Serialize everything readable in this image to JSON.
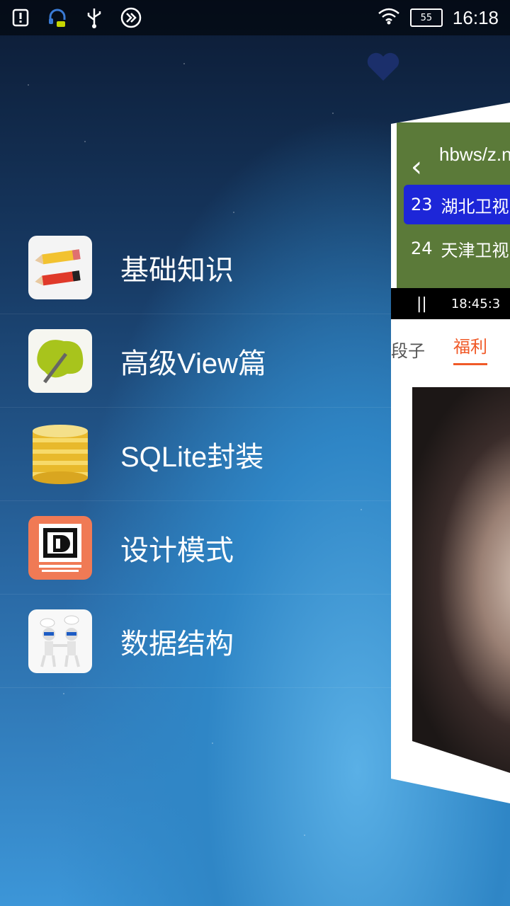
{
  "status_bar": {
    "icons": [
      "alert-icon",
      "headset-icon",
      "usb-icon",
      "fast-forward-icon"
    ],
    "battery_level": "55",
    "time": "16:18"
  },
  "menu": {
    "items": [
      {
        "label": "基础知识",
        "icon": "pencils-icon"
      },
      {
        "label": "高级View篇",
        "icon": "paint-icon"
      },
      {
        "label": "SQLite封装",
        "icon": "database-icon"
      },
      {
        "label": "设计模式",
        "icon": "square-d-icon"
      },
      {
        "label": "数据结构",
        "icon": "robots-icon"
      }
    ]
  },
  "preview": {
    "url_text": "hbws/z.n",
    "channels": [
      {
        "number": "23",
        "name": "湖北卫视"
      },
      {
        "number": "24",
        "name": "天津卫视"
      }
    ],
    "player_time": "18:45:3",
    "tabs": [
      "段子",
      "福利"
    ]
  },
  "colors": {
    "active_channel": "#1d26d8",
    "active_tab": "#f05a28"
  }
}
